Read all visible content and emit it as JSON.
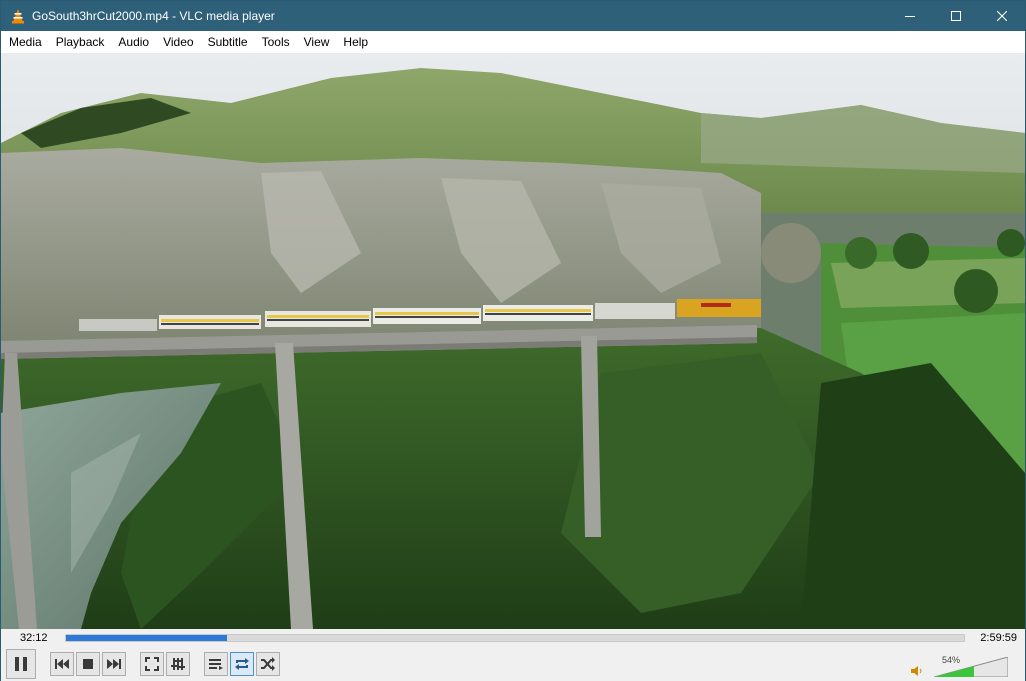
{
  "window": {
    "title": "GoSouth3hrCut2000.mp4 - VLC media player"
  },
  "menu": {
    "items": [
      "Media",
      "Playback",
      "Audio",
      "Video",
      "Subtitle",
      "Tools",
      "View",
      "Help"
    ]
  },
  "playback": {
    "elapsed": "32:12",
    "total": "2:59:59",
    "progress_fraction": 0.179
  },
  "controls": {
    "icons": [
      "pause-icon",
      "previous-icon",
      "stop-icon",
      "next-icon",
      "fullscreen-icon",
      "extended-settings-icon",
      "playlist-icon",
      "loop-icon",
      "shuffle-icon"
    ]
  },
  "volume": {
    "label": "54%",
    "level_fraction": 0.54
  },
  "colors": {
    "titlebar": "#2f6079",
    "seek_fill": "#2d7ad6",
    "volume_fill": "#3cc43c"
  }
}
